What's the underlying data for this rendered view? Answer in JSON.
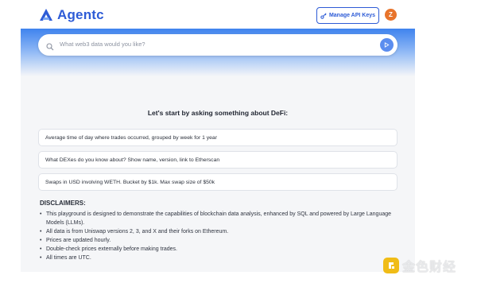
{
  "header": {
    "brand": "Agentc",
    "manage_keys_label": "Manage API Keys",
    "avatar_initial": "Z"
  },
  "search": {
    "placeholder": "What web3 data would you like?"
  },
  "main": {
    "heading": "Let's start by asking something about DeFi:",
    "suggestions": [
      "Average time of day where trades occurred, grouped by week for 1 year",
      "What DEXes do you know about? Show name, version, link to Etherscan",
      "Swaps in USD involving WETH. Bucket by $1k. Max swap size of $50k"
    ]
  },
  "disclaimers": {
    "title": "DISCLAIMERS:",
    "items": [
      "This playground is designed to demonstrate the capabilities of blockchain data analysis, enhanced by SQL and powered by Large Language Models (LLMs).",
      "All data is from Uniswap versions 2, 3, and X and their forks on Ethereum.",
      "Prices are updated hourly.",
      "Double-check prices externally before making trades.",
      "All times are UTC."
    ]
  },
  "watermark": {
    "text": "金色财经"
  },
  "colors": {
    "brand": "#2d5bd6",
    "avatar": "#e8742b",
    "hero_top": "#3f83ee",
    "send": "#5b8def"
  },
  "icons": [
    "agentc-logo-icon",
    "key-icon",
    "search-icon",
    "send-icon",
    "watermark-logo-icon"
  ]
}
